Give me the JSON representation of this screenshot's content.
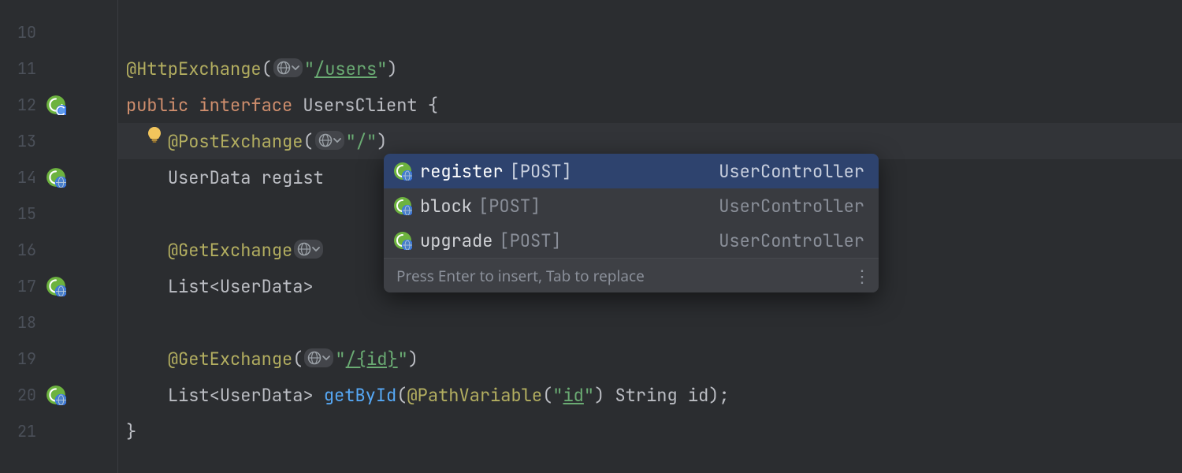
{
  "lines": {
    "10": "10",
    "11": "11",
    "12": "12",
    "13": "13",
    "14": "14",
    "15": "15",
    "16": "16",
    "17": "17",
    "18": "18",
    "19": "19",
    "20": "20",
    "21": "21"
  },
  "code": {
    "l11": {
      "ann": "@HttpExchange",
      "lp": "(",
      "str": "\"",
      "path": "/users",
      "strc": "\"",
      "rp": ")"
    },
    "l12": {
      "kw1": "public",
      "kw2": "interface",
      "name": "UsersClient",
      "brace": "{"
    },
    "l13": {
      "ann": "@PostExchange",
      "lp": "(",
      "str": "\"/\"",
      "rp": ")"
    },
    "l14": {
      "type": "UserData",
      "method": "regist"
    },
    "l16": {
      "ann": "@GetExchange"
    },
    "l17": {
      "type": "List",
      "lt": "<",
      "inner": "UserData",
      "gt": ">"
    },
    "l19": {
      "ann": "@GetExchange",
      "lp": "(",
      "strq": "\"",
      "path": "/{id}",
      "strqc": "\"",
      "rp": ")"
    },
    "l20": {
      "type": "List",
      "lt": "<",
      "inner": "UserData",
      "gt": ">",
      "method": "getById",
      "lp": "(",
      "ann": "@PathVariable",
      "alp": "(",
      "strq": "\"",
      "pv": "id",
      "strqc": "\"",
      "arp": ")",
      "sp": " ",
      "ptype": "String",
      "pname": "id",
      "rp": ");"
    },
    "l21": {
      "brace": "}"
    }
  },
  "popup": {
    "items": [
      {
        "name": "register",
        "method": "[POST]",
        "right": "UserController"
      },
      {
        "name": "block",
        "method": "[POST]",
        "right": "UserController"
      },
      {
        "name": "upgrade",
        "method": "[POST]",
        "right": "UserController"
      }
    ],
    "hint": "Press Enter to insert, Tab to replace",
    "dots": "⋮"
  }
}
